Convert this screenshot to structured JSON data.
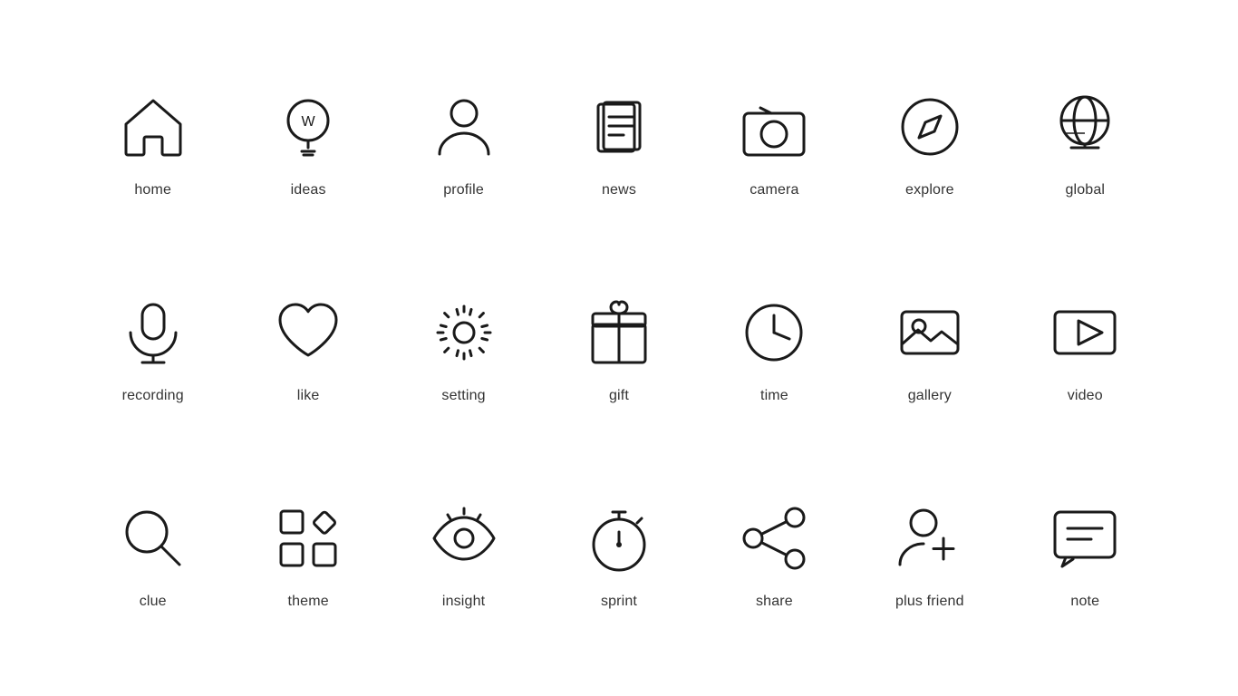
{
  "icons": [
    {
      "name": "home-icon",
      "label": "home"
    },
    {
      "name": "ideas-icon",
      "label": "ideas"
    },
    {
      "name": "profile-icon",
      "label": "profile"
    },
    {
      "name": "news-icon",
      "label": "news"
    },
    {
      "name": "camera-icon",
      "label": "camera"
    },
    {
      "name": "explore-icon",
      "label": "explore"
    },
    {
      "name": "global-icon",
      "label": "global"
    },
    {
      "name": "recording-icon",
      "label": "recording"
    },
    {
      "name": "like-icon",
      "label": "like"
    },
    {
      "name": "setting-icon",
      "label": "setting"
    },
    {
      "name": "gift-icon",
      "label": "gift"
    },
    {
      "name": "time-icon",
      "label": "time"
    },
    {
      "name": "gallery-icon",
      "label": "gallery"
    },
    {
      "name": "video-icon",
      "label": "video"
    },
    {
      "name": "clue-icon",
      "label": "clue"
    },
    {
      "name": "theme-icon",
      "label": "theme"
    },
    {
      "name": "insight-icon",
      "label": "insight"
    },
    {
      "name": "sprint-icon",
      "label": "sprint"
    },
    {
      "name": "share-icon",
      "label": "share"
    },
    {
      "name": "plus-friend-icon",
      "label": "plus friend"
    },
    {
      "name": "note-icon",
      "label": "note"
    }
  ]
}
